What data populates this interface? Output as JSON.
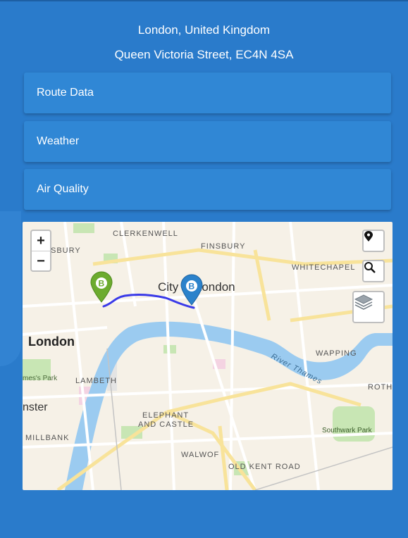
{
  "header": {
    "location": "London, United Kingdom",
    "address": "Queen Victoria Street, EC4N 4SA"
  },
  "accordion": [
    {
      "label": "Route Data"
    },
    {
      "label": "Weather"
    },
    {
      "label": "Air Quality"
    }
  ],
  "map": {
    "zoom_in": "+",
    "zoom_out": "−",
    "labels": {
      "clerkenwell": "CLERKENWELL",
      "finsbury": "FINSBURY",
      "sbury": "SBURY",
      "whitechapel": "WHITECHAPEL",
      "city": "City of London",
      "london": "London",
      "james_park": "mes's Park",
      "lambeth": "LAMBETH",
      "wapping": "WAPPING",
      "river": "River Thames",
      "rothe": "ROTHE",
      "nster": "nster",
      "elephant1": "ELEPHANT",
      "elephant2": "AND CASTLE",
      "millbank": "MILLBANK",
      "southwark_park": "Southwark Park",
      "walworth": "WALWOF",
      "old_kent_road": "OLD KENT ROAD"
    },
    "markers": [
      {
        "name": "start",
        "letter": "B",
        "color": "#6cab2e"
      },
      {
        "name": "end",
        "letter": "B",
        "color": "#2b82cb"
      }
    ],
    "route_color": "#3a3ae8"
  }
}
